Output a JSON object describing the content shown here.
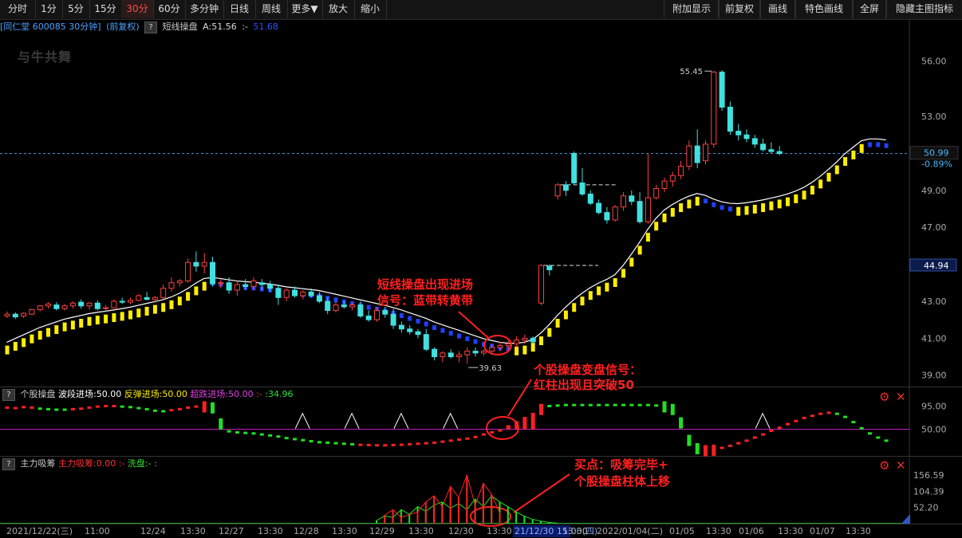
{
  "toolbar": {
    "left": [
      "分时",
      "1分",
      "5分",
      "15分",
      "30分",
      "60分",
      "多分钟",
      "日线",
      "周线",
      "更多▼",
      "放大",
      "缩小"
    ],
    "active": "30分",
    "right": [
      "附加显示",
      "前复权",
      "画线",
      "特色画线",
      "全屏",
      "隐藏主图指标"
    ]
  },
  "info": {
    "stock": "[同仁堂 600085 30分钟]",
    "adjust": "(前复权)",
    "help": "?",
    "indicator": "短线操盘",
    "a_value": "A:51.56",
    "sep": ":-",
    "b_value": "51.68"
  },
  "watermark": "与牛共舞",
  "panel2": {
    "help": "?",
    "name": "个股操盘",
    "f1": "波段进场:50.00",
    "f2": "反弹进场:50.00",
    "f3": "超跌进场:50.00",
    "f4": ":-",
    "f5": ":34.96"
  },
  "panel3": {
    "help": "?",
    "name": "主力吸筹",
    "f1": "主力吸筹:0.00",
    "f2": ":-",
    "f3": "洗盘:-",
    "f4": ":"
  },
  "colors": {
    "up": "#ff4040",
    "down": "#40e0e0",
    "yellow": "#ffee00",
    "blue": "#2040ff",
    "annotation": "#ff2020",
    "magenta": "#d020d0",
    "green": "#20e020"
  },
  "annotations": {
    "a1_line1": "短线操盘出现进场",
    "a1_line2": "信号：蓝带转黄带",
    "a2_line1": "个股操盘变盘信号：",
    "a2_line2": "红柱出现且突破50",
    "a3_line1": "买点：吸筹完毕+",
    "a3_line2": "个股操盘柱体上移"
  },
  "chart_data": [
    {
      "type": "candlestick",
      "title": "同仁堂 600085 30分钟",
      "y_axis_ticks": [
        "56.00",
        "53.00",
        "51.00",
        "49.00",
        "47.00",
        "45.00",
        "43.00",
        "41.00",
        "39.00"
      ],
      "y_axis_values": [
        56.0,
        53.0,
        51.0,
        49.0,
        47.0,
        45.0,
        43.0,
        41.0,
        39.0
      ],
      "ylim": [
        38.6,
        57.4
      ],
      "current_price": "50.99",
      "change_pct": "-0.89%",
      "price_marker": "44.94",
      "high_label": "55.45",
      "low_label": "39.63",
      "candles": [
        [
          42.2,
          42.45,
          42.1,
          42.3
        ],
        [
          42.3,
          42.4,
          42.05,
          42.15
        ],
        [
          42.2,
          42.4,
          42.1,
          42.35
        ],
        [
          42.3,
          42.6,
          42.25,
          42.55
        ],
        [
          42.55,
          42.8,
          42.45,
          42.75
        ],
        [
          42.75,
          42.95,
          42.6,
          42.85
        ],
        [
          42.8,
          42.95,
          42.5,
          42.6
        ],
        [
          42.6,
          42.85,
          42.5,
          42.75
        ],
        [
          42.75,
          43.0,
          42.6,
          42.9
        ],
        [
          42.95,
          43.1,
          42.6,
          42.75
        ],
        [
          42.75,
          42.95,
          42.55,
          42.9
        ],
        [
          42.9,
          43.05,
          42.5,
          42.6
        ],
        [
          42.6,
          42.8,
          42.45,
          42.65
        ],
        [
          42.65,
          43.1,
          42.6,
          43.0
        ],
        [
          43.0,
          43.2,
          42.85,
          42.95
        ],
        [
          42.95,
          43.2,
          42.85,
          43.05
        ],
        [
          43.05,
          43.4,
          43.0,
          43.3
        ],
        [
          43.2,
          43.5,
          43.05,
          43.1
        ],
        [
          43.1,
          43.3,
          42.9,
          43.2
        ],
        [
          43.2,
          43.9,
          43.1,
          43.7
        ],
        [
          43.7,
          44.3,
          43.5,
          44.0
        ],
        [
          44.0,
          44.2,
          43.8,
          44.1
        ],
        [
          44.1,
          45.3,
          44.0,
          45.1
        ],
        [
          45.1,
          45.7,
          44.6,
          44.9
        ],
        [
          44.9,
          45.6,
          44.5,
          45.1
        ],
        [
          45.1,
          45.4,
          43.8,
          43.95
        ],
        [
          43.95,
          44.2,
          43.7,
          44.0
        ],
        [
          44.0,
          44.3,
          43.4,
          43.6
        ],
        [
          43.6,
          44.1,
          43.3,
          43.9
        ],
        [
          43.9,
          44.2,
          43.6,
          43.8
        ],
        [
          43.8,
          44.3,
          43.6,
          44.1
        ],
        [
          44.0,
          44.2,
          43.6,
          43.9
        ],
        [
          43.9,
          44.1,
          43.5,
          43.7
        ],
        [
          43.7,
          43.9,
          42.8,
          43.2
        ],
        [
          43.2,
          43.7,
          43.0,
          43.6
        ],
        [
          43.6,
          43.8,
          43.2,
          43.3
        ],
        [
          43.3,
          43.6,
          43.1,
          43.5
        ],
        [
          43.5,
          43.7,
          43.2,
          43.3
        ],
        [
          43.3,
          43.5,
          42.9,
          43.0
        ],
        [
          43.0,
          43.2,
          42.3,
          42.5
        ],
        [
          42.5,
          43.0,
          42.4,
          42.8
        ],
        [
          42.8,
          43.0,
          42.6,
          42.7
        ],
        [
          42.7,
          42.9,
          42.5,
          42.8
        ],
        [
          42.8,
          43.0,
          42.1,
          42.2
        ],
        [
          42.2,
          42.5,
          41.9,
          42.0
        ],
        [
          42.0,
          42.7,
          41.9,
          42.5
        ],
        [
          42.5,
          42.7,
          42.1,
          42.3
        ],
        [
          42.3,
          42.6,
          41.5,
          41.7
        ],
        [
          41.7,
          41.9,
          41.3,
          41.5
        ],
        [
          41.5,
          41.7,
          41.2,
          41.35
        ],
        [
          41.35,
          41.5,
          41.0,
          41.2
        ],
        [
          41.2,
          41.5,
          40.3,
          40.4
        ],
        [
          40.4,
          40.5,
          39.8,
          40.0
        ],
        [
          40.0,
          40.3,
          39.7,
          40.2
        ],
        [
          40.2,
          40.4,
          39.9,
          40.0
        ],
        [
          40.0,
          40.3,
          39.7,
          40.1
        ],
        [
          40.1,
          40.5,
          39.63,
          40.3
        ],
        [
          40.3,
          40.5,
          40.0,
          40.2
        ],
        [
          40.2,
          40.4,
          40.05,
          40.3
        ],
        [
          40.3,
          40.7,
          40.1,
          40.5
        ],
        [
          40.5,
          40.8,
          40.3,
          40.6
        ],
        [
          40.6,
          40.9,
          40.4,
          40.7
        ],
        [
          40.7,
          41.1,
          40.5,
          40.9
        ],
        [
          40.9,
          41.2,
          40.7,
          41.0
        ],
        [
          41.0,
          41.1,
          40.7,
          40.8
        ],
        [
          42.9,
          45.0,
          42.8,
          44.94
        ],
        [
          44.9,
          45.0,
          44.4,
          44.7
        ],
        [
          48.7,
          49.4,
          48.5,
          49.3
        ],
        [
          49.3,
          49.5,
          48.7,
          49.0
        ],
        [
          51.0,
          51.1,
          49.3,
          49.4
        ],
        [
          49.4,
          50.2,
          48.7,
          48.8
        ],
        [
          48.8,
          49.0,
          48.2,
          48.3
        ],
        [
          48.3,
          48.5,
          47.7,
          47.8
        ],
        [
          47.8,
          48.1,
          47.2,
          47.4
        ],
        [
          47.4,
          48.2,
          47.3,
          48.1
        ],
        [
          48.1,
          48.9,
          47.9,
          48.7
        ],
        [
          48.7,
          49.0,
          48.2,
          48.4
        ],
        [
          48.4,
          48.9,
          47.2,
          47.3
        ],
        [
          47.3,
          51.0,
          47.2,
          48.6
        ],
        [
          48.6,
          49.3,
          48.5,
          49.1
        ],
        [
          49.1,
          49.7,
          48.9,
          49.5
        ],
        [
          49.5,
          50.0,
          49.2,
          49.8
        ],
        [
          49.8,
          50.6,
          49.6,
          50.3
        ],
        [
          50.3,
          51.7,
          50.1,
          51.4
        ],
        [
          51.4,
          52.3,
          50.2,
          50.5
        ],
        [
          50.6,
          51.7,
          50.4,
          51.5
        ],
        [
          51.5,
          55.45,
          51.3,
          55.4
        ],
        [
          55.4,
          55.5,
          53.3,
          53.5
        ],
        [
          53.5,
          53.8,
          52.0,
          52.2
        ],
        [
          52.2,
          52.6,
          51.7,
          52.0
        ],
        [
          52.0,
          52.3,
          51.6,
          51.8
        ],
        [
          51.8,
          52.0,
          51.3,
          51.5
        ],
        [
          51.5,
          51.8,
          51.1,
          51.2
        ],
        [
          51.2,
          51.6,
          51.0,
          51.1
        ],
        [
          51.1,
          51.4,
          50.9,
          50.99
        ]
      ],
      "band": [
        40.6,
        40.8,
        41.0,
        41.2,
        41.4,
        41.55,
        41.7,
        41.85,
        41.95,
        42.05,
        42.15,
        42.22,
        42.28,
        42.35,
        42.42,
        42.5,
        42.6,
        42.7,
        42.8,
        42.9,
        43.05,
        43.25,
        43.5,
        43.8,
        44.05,
        44.1,
        44.05,
        43.98,
        43.92,
        43.88,
        43.85,
        43.8,
        43.75,
        43.68,
        43.6,
        43.55,
        43.5,
        43.45,
        43.4,
        43.3,
        43.2,
        43.1,
        43.0,
        42.9,
        42.8,
        42.7,
        42.6,
        42.48,
        42.35,
        42.2,
        42.05,
        41.9,
        41.7,
        41.55,
        41.4,
        41.25,
        41.1,
        40.95,
        40.8,
        40.7,
        40.6,
        40.55,
        40.55,
        40.6,
        40.75,
        41.1,
        41.55,
        42.05,
        42.5,
        42.9,
        43.25,
        43.55,
        43.8,
        44.0,
        44.25,
        44.75,
        45.35,
        46.0,
        46.7,
        47.3,
        47.75,
        48.05,
        48.3,
        48.5,
        48.65,
        48.55,
        48.35,
        48.2,
        48.12,
        48.1,
        48.15,
        48.22,
        48.3,
        48.4,
        48.5,
        48.62,
        48.78,
        48.98,
        49.25,
        49.58,
        49.95,
        50.35,
        50.8,
        51.15,
        51.5,
        51.6,
        51.6,
        51.55
      ],
      "band_color": [
        "y",
        "y",
        "y",
        "y",
        "y",
        "y",
        "y",
        "y",
        "y",
        "y",
        "y",
        "y",
        "y",
        "y",
        "y",
        "y",
        "y",
        "y",
        "y",
        "y",
        "y",
        "y",
        "y",
        "y",
        "y",
        "b",
        "b",
        "b",
        "b",
        "b",
        "b",
        "b",
        "b",
        "b",
        "b",
        "b",
        "b",
        "b",
        "b",
        "b",
        "b",
        "b",
        "b",
        "b",
        "b",
        "b",
        "b",
        "b",
        "b",
        "b",
        "b",
        "b",
        "b",
        "b",
        "b",
        "b",
        "b",
        "b",
        "b",
        "b",
        "b",
        "b",
        "y",
        "y",
        "y",
        "y",
        "y",
        "y",
        "y",
        "y",
        "y",
        "y",
        "y",
        "y",
        "y",
        "y",
        "y",
        "y",
        "y",
        "y",
        "y",
        "y",
        "y",
        "y",
        "y",
        "b",
        "b",
        "b",
        "b",
        "y",
        "y",
        "y",
        "y",
        "y",
        "y",
        "y",
        "y",
        "y",
        "y",
        "y",
        "y",
        "y",
        "y",
        "y",
        "y",
        "b",
        "b",
        "b"
      ],
      "x_labels": [
        "2021/12/22(三)",
        "11:00",
        "12/24",
        "13:30",
        "12/27",
        "13:30",
        "12/28",
        "13:30",
        "12/29",
        "13:30",
        "12/30",
        "13:30",
        "21/12/30 15:00(四)",
        "13:30",
        "2022/01/04(二)",
        "01/05",
        "13:30",
        "01/06",
        "13:30",
        "01/07",
        "13:30"
      ]
    },
    {
      "type": "bar",
      "title": "个股操盘",
      "y_axis_ticks": [
        "95.00",
        "50.00"
      ],
      "y_axis_values": [
        95.0,
        50.0
      ],
      "ylim": [
        0,
        105
      ],
      "values": [
        92,
        91,
        93,
        92,
        90,
        89,
        88,
        88,
        89,
        90,
        92,
        94,
        95,
        95,
        94,
        93,
        91,
        89,
        86,
        85,
        87,
        89,
        92,
        94,
        95,
        93,
        62,
        46,
        44,
        43,
        42,
        40,
        38,
        36,
        33,
        31,
        29,
        27,
        25,
        24,
        23,
        22,
        21,
        20,
        19.5,
        19,
        19,
        19.5,
        20,
        21,
        22,
        23,
        24,
        26,
        28,
        30,
        32,
        35,
        40,
        44,
        50,
        58,
        66,
        74,
        82,
        90,
        95,
        96,
        97,
        97,
        97,
        97,
        97,
        97,
        97,
        97,
        97,
        97,
        97,
        96,
        95,
        90,
        64,
        30,
        14,
        10,
        11,
        14,
        18,
        23,
        28,
        34,
        40,
        47,
        53,
        60,
        66,
        72,
        76,
        80,
        82,
        80,
        74,
        64,
        52,
        42,
        34,
        28
      ],
      "colors": [
        "r",
        "r",
        "r",
        "r",
        "g",
        "g",
        "g",
        "g",
        "r",
        "r",
        "r",
        "r",
        "r",
        "r",
        "g",
        "g",
        "g",
        "g",
        "g",
        "g",
        "r",
        "r",
        "r",
        "r",
        "r",
        "g",
        "g",
        "g",
        "g",
        "g",
        "g",
        "g",
        "g",
        "g",
        "g",
        "g",
        "g",
        "g",
        "g",
        "g",
        "g",
        "g",
        "g",
        "r",
        "r",
        "r",
        "r",
        "r",
        "r",
        "r",
        "r",
        "r",
        "r",
        "r",
        "r",
        "r",
        "r",
        "r",
        "r",
        "r",
        "r",
        "r",
        "r",
        "r",
        "r",
        "r",
        "g",
        "g",
        "g",
        "g",
        "g",
        "g",
        "g",
        "g",
        "g",
        "g",
        "g",
        "g",
        "g",
        "g",
        "g",
        "g",
        "g",
        "g",
        "g",
        "r",
        "r",
        "r",
        "r",
        "r",
        "r",
        "r",
        "r",
        "r",
        "r",
        "r",
        "r",
        "r",
        "r",
        "r",
        "r",
        "g",
        "g",
        "g",
        "g",
        "g",
        "g",
        "g"
      ],
      "triangles_at": [
        36,
        42,
        48,
        54,
        92
      ]
    },
    {
      "type": "bar",
      "title": "主力吸筹",
      "y_axis_ticks": [
        "156.59",
        "104.39",
        "52.20"
      ],
      "y_axis_values": [
        156.59,
        104.39,
        52.2
      ],
      "ylim": [
        0,
        170
      ],
      "red": [
        [
          46,
          28
        ],
        [
          47,
          45
        ],
        [
          48,
          20
        ],
        [
          50,
          38
        ],
        [
          51,
          70
        ],
        [
          52,
          90
        ],
        [
          53,
          55
        ],
        [
          54,
          120
        ],
        [
          55,
          85
        ],
        [
          56,
          156.59
        ],
        [
          57,
          60
        ],
        [
          58,
          130
        ],
        [
          59,
          95
        ],
        [
          60,
          35
        ]
      ],
      "green": [
        [
          45,
          10
        ],
        [
          46,
          25
        ],
        [
          47,
          20
        ],
        [
          48,
          45
        ],
        [
          49,
          30
        ],
        [
          50,
          55
        ],
        [
          51,
          40
        ],
        [
          52,
          60
        ],
        [
          53,
          70
        ],
        [
          54,
          50
        ],
        [
          55,
          65
        ],
        [
          56,
          45
        ],
        [
          57,
          80
        ],
        [
          58,
          55
        ],
        [
          59,
          90
        ],
        [
          60,
          70
        ],
        [
          61,
          55
        ],
        [
          62,
          38
        ],
        [
          63,
          24
        ],
        [
          64,
          14
        ],
        [
          65,
          8
        ],
        [
          66,
          4
        ],
        [
          67,
          2
        ]
      ]
    }
  ]
}
